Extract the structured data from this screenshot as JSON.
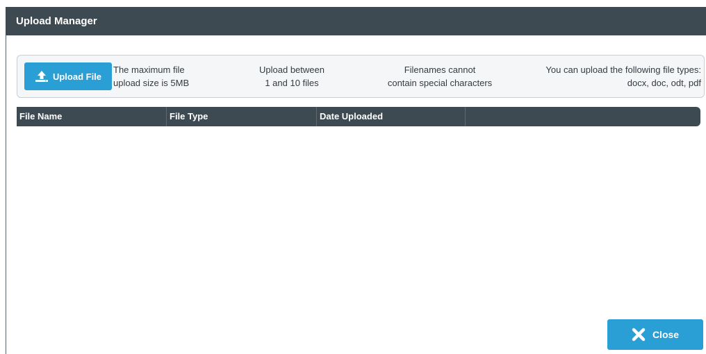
{
  "window": {
    "title": "Upload Manager"
  },
  "upload": {
    "button_label": "Upload File",
    "button_icon": "upload-icon",
    "info": [
      {
        "line1": "The maximum file",
        "line2": "upload size is 5MB"
      },
      {
        "line1": "Upload between",
        "line2": "1 and 10 files"
      },
      {
        "line1": "Filenames cannot",
        "line2": "contain special characters"
      },
      {
        "line1": "You can upload the following file types:",
        "line2": "docx, doc, odt, pdf"
      }
    ]
  },
  "table": {
    "columns": [
      "File Name",
      "File Type",
      "Date Uploaded",
      ""
    ],
    "rows": []
  },
  "footer": {
    "close_label": "Close",
    "close_icon": "close-x-icon"
  },
  "colors": {
    "header_bg": "#3e4a52",
    "accent": "#2a9fd6",
    "panel_bg": "#f4f6f8"
  }
}
